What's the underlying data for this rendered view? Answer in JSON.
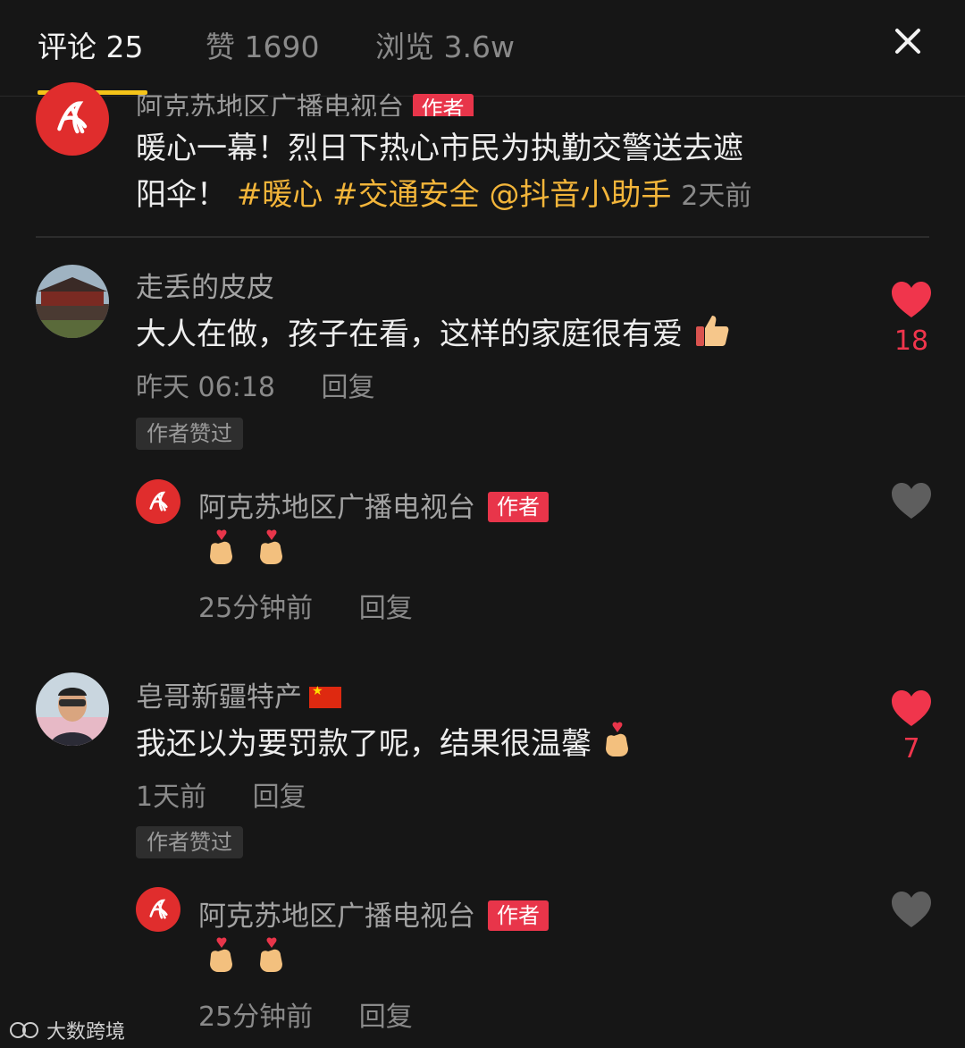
{
  "header": {
    "tabs": [
      {
        "label": "评论 25",
        "active": true
      },
      {
        "label": "赞 1690",
        "active": false
      },
      {
        "label": "浏览 3.6w",
        "active": false
      }
    ],
    "accent": "#f5c419"
  },
  "post": {
    "author_name": "阿克苏地区广播电视台",
    "author_tag": "作者",
    "text_line1": "暖心一幕！烈日下热心市民为执勤交警送去遮",
    "text_line2": "阳伞！",
    "tags": [
      "#暖心",
      "#交通安全",
      "@抖音小助手"
    ],
    "time": "2天前"
  },
  "comments": [
    {
      "username": "走丢的皮皮",
      "text": "大人在做，孩子在看，这样的家庭很有爱",
      "emoji": "thumbs-up-icon",
      "time": "昨天 06:18",
      "reply_label": "回复",
      "liked_badge": "作者赞过",
      "likes": "18",
      "reply": {
        "username": "阿克苏地区广播电视台",
        "tag": "作者",
        "emojis": [
          "finger-heart-icon",
          "finger-heart-icon"
        ],
        "time": "25分钟前",
        "reply_label": "回复"
      }
    },
    {
      "username": "皂哥新疆特产",
      "flag": "china-flag-icon",
      "text": "我还以为要罚款了呢，结果很温馨",
      "emoji": "finger-heart-icon",
      "time": "1天前",
      "reply_label": "回复",
      "liked_badge": "作者赞过",
      "likes": "7",
      "reply": {
        "username": "阿克苏地区广播电视台",
        "tag": "作者",
        "emojis": [
          "finger-heart-icon",
          "finger-heart-icon"
        ],
        "time": "25分钟前",
        "reply_label": "回复"
      }
    }
  ],
  "watermark": "大数跨境",
  "colors": {
    "like_red": "#f0354c",
    "tag_orange": "#f3b53a",
    "author_badge": "#e8354a",
    "background": "#161616"
  }
}
